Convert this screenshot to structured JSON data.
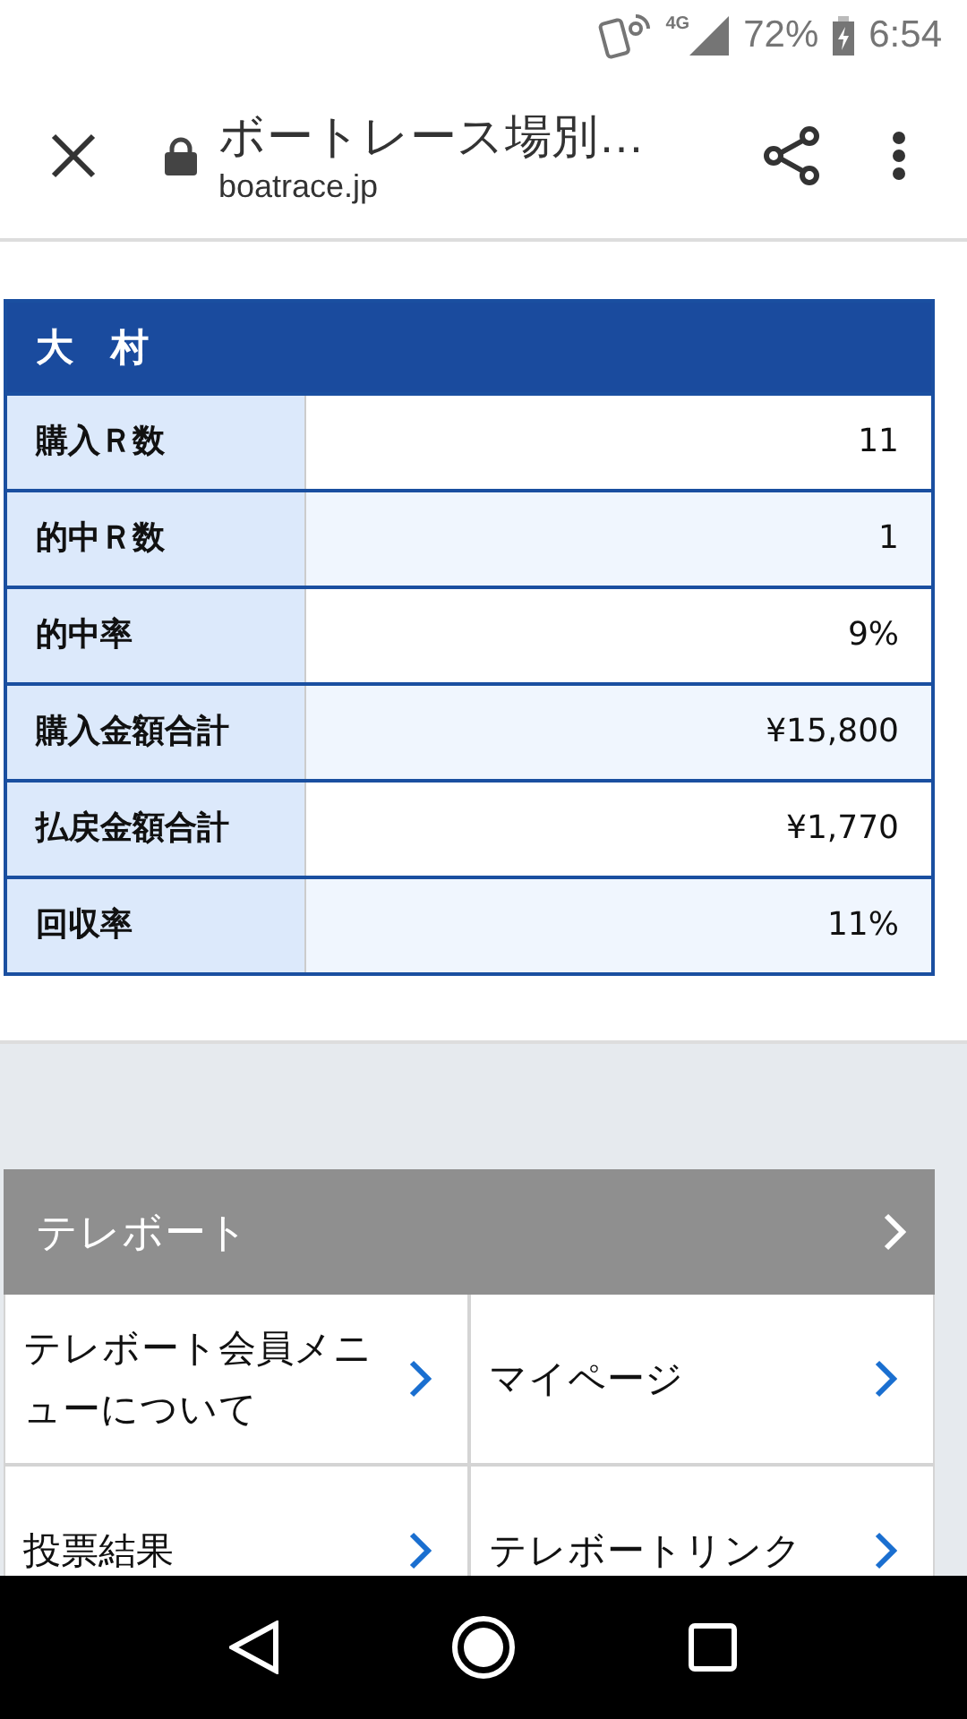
{
  "status_bar": {
    "network": "4G",
    "battery": "72%",
    "time": "6:54"
  },
  "browser": {
    "title": "ボートレース場別…",
    "url": "boatrace.jp"
  },
  "stats": {
    "title": "大　村",
    "rows": [
      {
        "label": "購入Ｒ数",
        "value": "11"
      },
      {
        "label": "的中Ｒ数",
        "value": "1"
      },
      {
        "label": "的中率",
        "value": "9%"
      },
      {
        "label": "購入金額合計",
        "value": "¥15,800"
      },
      {
        "label": "払戻金額合計",
        "value": "¥1,770"
      },
      {
        "label": "回収率",
        "value": "11%"
      }
    ]
  },
  "teleboat": {
    "title": "テレボート",
    "links": [
      {
        "label": "テレボート会員メニューについて"
      },
      {
        "label": "マイページ"
      },
      {
        "label": "投票結果"
      },
      {
        "label": "テレボートリンク"
      }
    ]
  }
}
